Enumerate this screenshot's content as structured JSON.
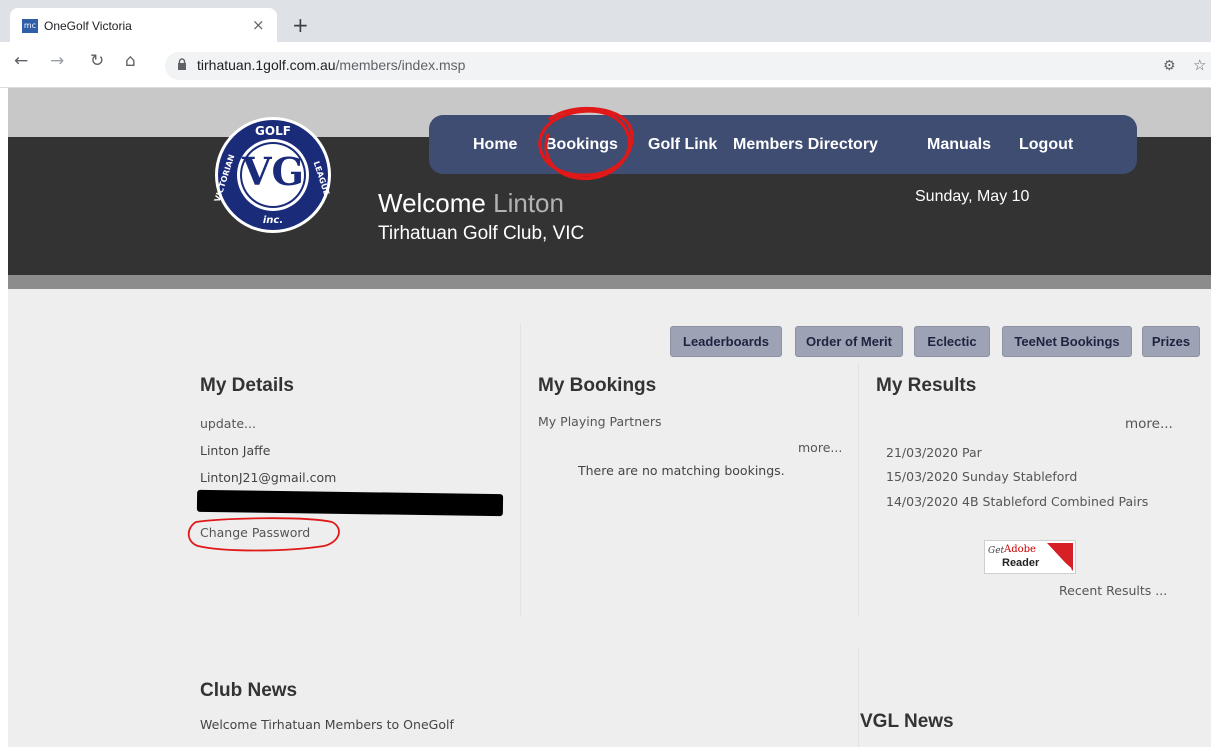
{
  "browser": {
    "tab_favicon": "mc",
    "tab_title": "OneGolf Victoria",
    "tab_close": "×",
    "new_tab": "+",
    "url_host": "tirhatuan.1golf.com.au",
    "url_path": "/members/index.msp",
    "icons": [
      "back-icon",
      "forward-icon",
      "reload-icon",
      "home-icon",
      "lock-icon",
      "extension-icon",
      "star-icon"
    ]
  },
  "header": {
    "logo_text": {
      "top": "GOLF",
      "left": "VICTORIAN",
      "right": "LEAGUE",
      "bottom": "inc."
    },
    "nav": [
      "Home",
      "Bookings",
      "Golf Link",
      "Members Directory",
      "Manuals",
      "Logout"
    ],
    "welcome_prefix": "Welcome",
    "welcome_name": "Linton",
    "club": "Tirhatuan Golf Club, VIC",
    "date": "Sunday, May 10"
  },
  "quick_links": [
    "Leaderboards",
    "Order of Merit",
    "Eclectic",
    "TeeNet Bookings",
    "Prizes"
  ],
  "my_details": {
    "title": "My Details",
    "update": "update...",
    "name": "Linton Jaffe",
    "email": "LintonJ21@gmail.com",
    "change_password": "Change Password"
  },
  "my_bookings": {
    "title": "My Bookings",
    "partners": "My Playing Partners",
    "more": "more...",
    "empty": "There are no matching bookings."
  },
  "my_results": {
    "title": "My Results",
    "more": "more...",
    "results": [
      {
        "date": "21/03/2020",
        "event": "Par"
      },
      {
        "date": "15/03/2020",
        "event": "Sunday Stableford"
      },
      {
        "date": "14/03/2020",
        "event": "4B Stableford Combined Pairs"
      }
    ],
    "adobe": {
      "get": "Get",
      "brand": "Adobe",
      "reader": "Reader"
    },
    "recent": "Recent Results ..."
  },
  "club_news": {
    "title": "Club News",
    "item": "Welcome Tirhatuan Members to OneGolf"
  },
  "vgl_news": {
    "title": "VGL News"
  },
  "colors": {
    "header_bg": "#333333",
    "navbar_bg": "#3f4d72",
    "button_bg": "#9da3b4",
    "annotation_red": "#e01818"
  }
}
